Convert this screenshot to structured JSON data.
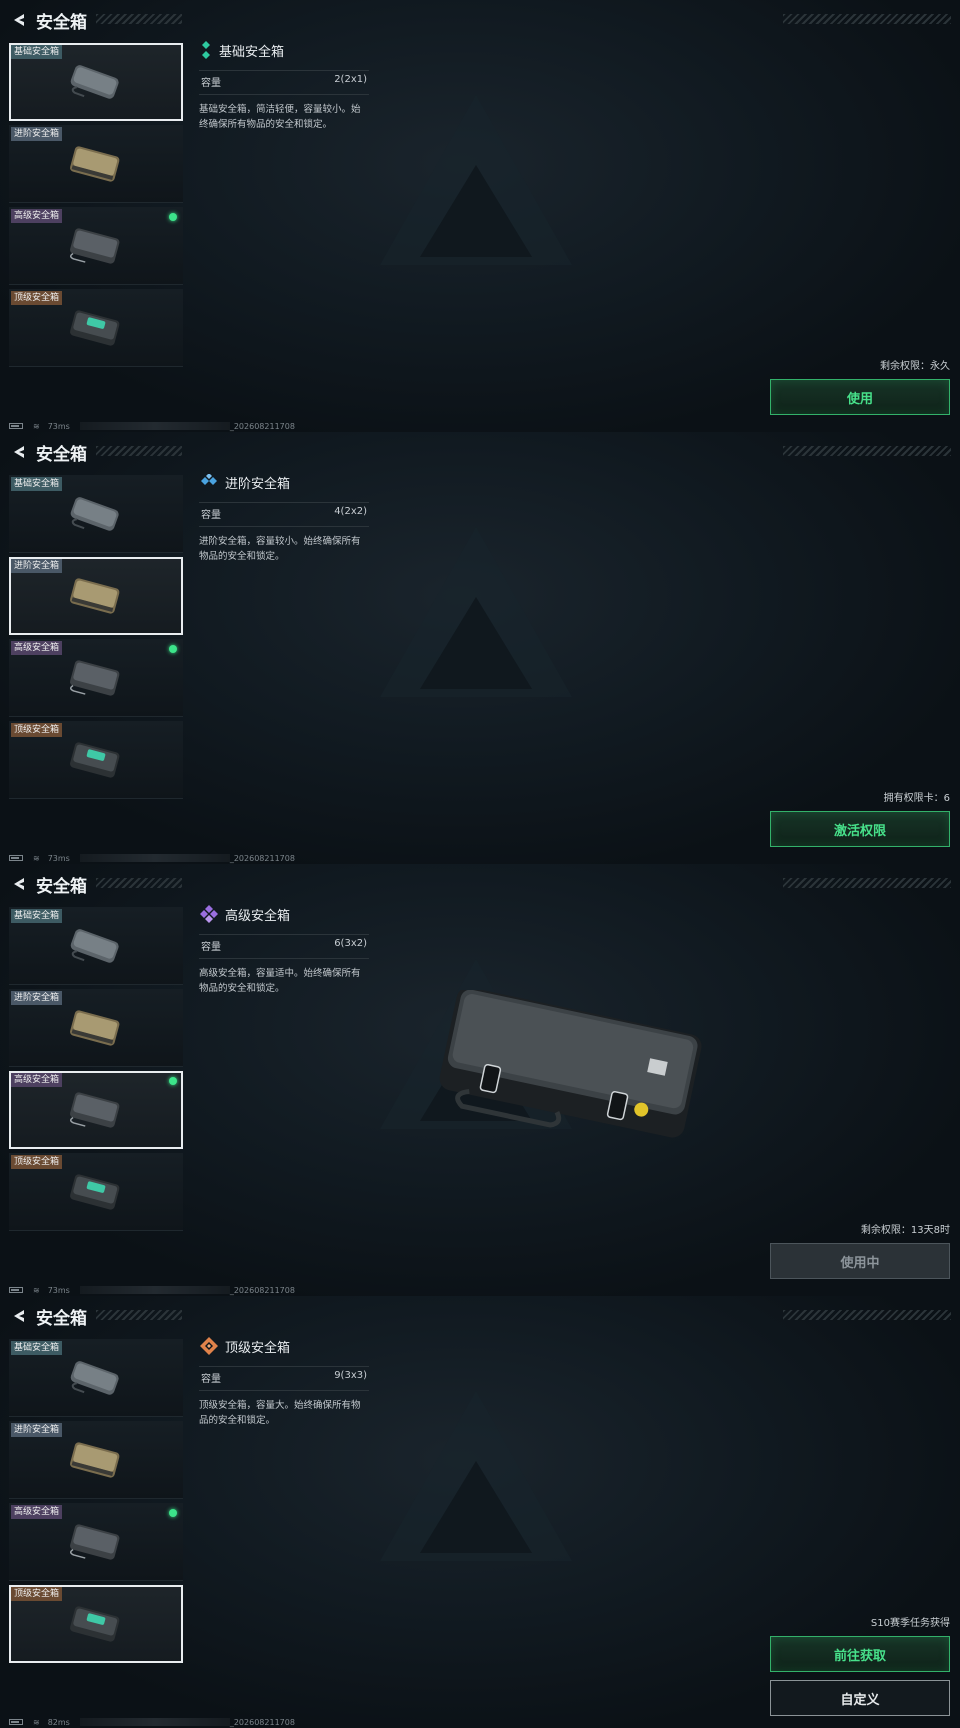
{
  "items": [
    "基础安全箱",
    "进阶安全箱",
    "高级安全箱",
    "顶级安全箱"
  ],
  "screens": [
    {
      "title": "安全箱",
      "detail": {
        "name": "基础安全箱",
        "capacity_label": "容量",
        "capacity_value": "2(2x1)",
        "desc": "基础安全箱，简洁轻便，容量较小。始终确保所有物品的安全和锁定。"
      },
      "remain": "剩余权限：永久",
      "button": "使用",
      "ping": "73ms",
      "build": "_202608211708"
    },
    {
      "title": "安全箱",
      "detail": {
        "name": "进阶安全箱",
        "capacity_label": "容量",
        "capacity_value": "4(2x2)",
        "desc": "进阶安全箱，容量较小。始终确保所有物品的安全和锁定。"
      },
      "remain": "拥有权限卡：6",
      "button": "激活权限",
      "ping": "73ms",
      "build": "_202608211708"
    },
    {
      "title": "安全箱",
      "detail": {
        "name": "高级安全箱",
        "capacity_label": "容量",
        "capacity_value": "6(3x2)",
        "desc": "高级安全箱，容量适中。始终确保所有物品的安全和锁定。"
      },
      "remain": "剩余权限：13天8时",
      "button": "使用中",
      "ping": "73ms",
      "build": "_202608211708"
    },
    {
      "title": "安全箱",
      "detail": {
        "name": "顶级安全箱",
        "capacity_label": "容量",
        "capacity_value": "9(3x3)",
        "desc": "顶级安全箱，容量大。始终确保所有物品的安全和锁定。"
      },
      "remain": "S10赛季任务获得",
      "button": "前往获取",
      "button2": "自定义",
      "ping": "82ms",
      "build": "_202608211708"
    }
  ],
  "colors": {
    "accent_green": "#47e08a",
    "basic": "#3d5b63",
    "advanced": "#4a5867",
    "high": "#4d4060",
    "top": "#6a4a32",
    "icon_basic": "#2ec9a0",
    "icon_adv": "#4aa3e0",
    "icon_high": "#9a6ee0",
    "icon_top": "#e0824a"
  }
}
